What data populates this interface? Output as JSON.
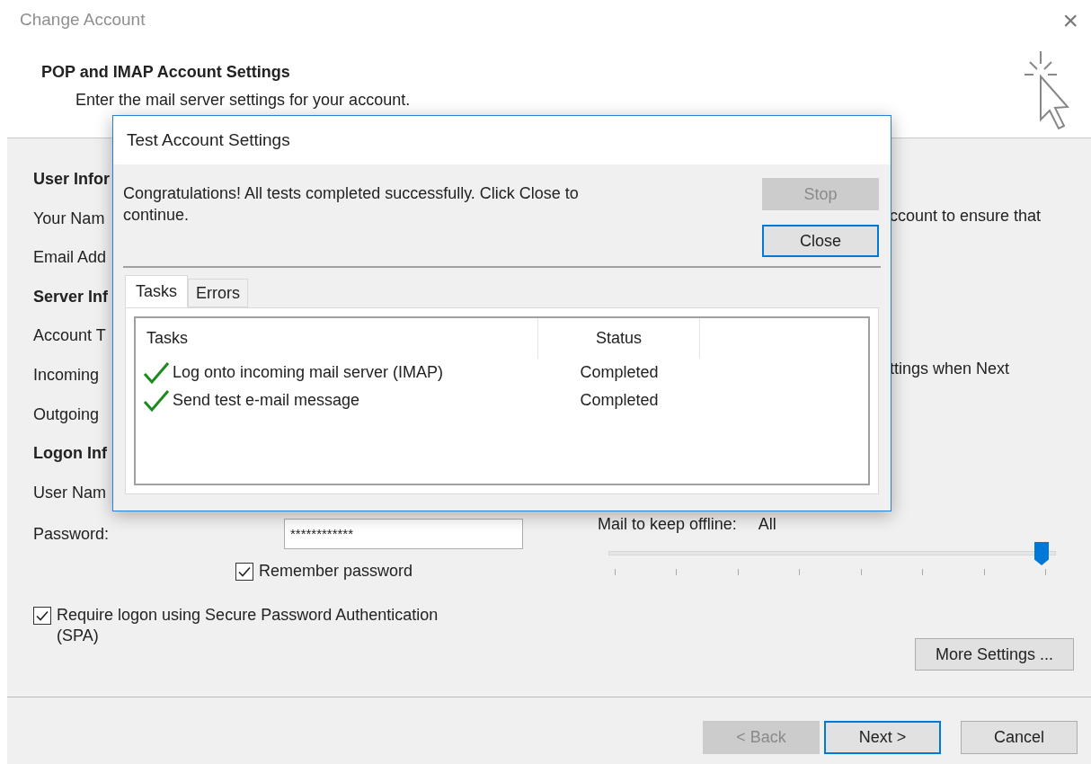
{
  "window": {
    "title": "Change Account",
    "close": "×"
  },
  "header": {
    "title": "POP and IMAP Account Settings",
    "subtitle": "Enter the mail server settings for your account."
  },
  "left_labels": [
    {
      "kind": "heading",
      "text": "User Infor"
    },
    {
      "kind": "label",
      "text": "Your Nam"
    },
    {
      "kind": "label",
      "text": "Email Add"
    },
    {
      "kind": "heading",
      "text": "Server Inf"
    },
    {
      "kind": "label",
      "text": "Account T"
    },
    {
      "kind": "label",
      "text": "Incoming"
    },
    {
      "kind": "label",
      "text": "Outgoing"
    },
    {
      "kind": "heading",
      "text": "Logon Inf"
    },
    {
      "kind": "label",
      "text": "User Nam"
    }
  ],
  "password": {
    "label": "Password:",
    "value": "************"
  },
  "remember_password": {
    "label": "Remember password",
    "checked": true
  },
  "spa": {
    "label": "Require logon using Secure Password Authentication (SPA)",
    "checked": true
  },
  "right_texts": [
    "ccount to ensure that",
    "ttings when Next"
  ],
  "offline": {
    "label": "Mail to keep offline:",
    "value": "All",
    "level": 1
  },
  "more_settings": "More Settings ...",
  "footer_buttons": [
    {
      "label": "< Back",
      "disabled": true,
      "focused": false
    },
    {
      "label": "Next >",
      "disabled": false,
      "focused": true
    },
    {
      "label": "Cancel",
      "disabled": false,
      "focused": false
    }
  ],
  "dialog": {
    "title": "Test Account Settings",
    "message": "Congratulations! All tests completed successfully. Click Close to continue.",
    "buttons": [
      {
        "label": "Stop",
        "disabled": true,
        "focused": false
      },
      {
        "label": "Close",
        "disabled": false,
        "focused": true
      }
    ],
    "tabs": [
      {
        "label": "Tasks",
        "selected": true
      },
      {
        "label": "Errors",
        "selected": false
      }
    ],
    "columns": [
      "Tasks",
      "Status"
    ],
    "rows": [
      {
        "task": "Log onto incoming mail server (IMAP)",
        "status": "Completed",
        "done": true
      },
      {
        "task": "Send test e-mail message",
        "status": "Completed",
        "done": true
      }
    ]
  }
}
